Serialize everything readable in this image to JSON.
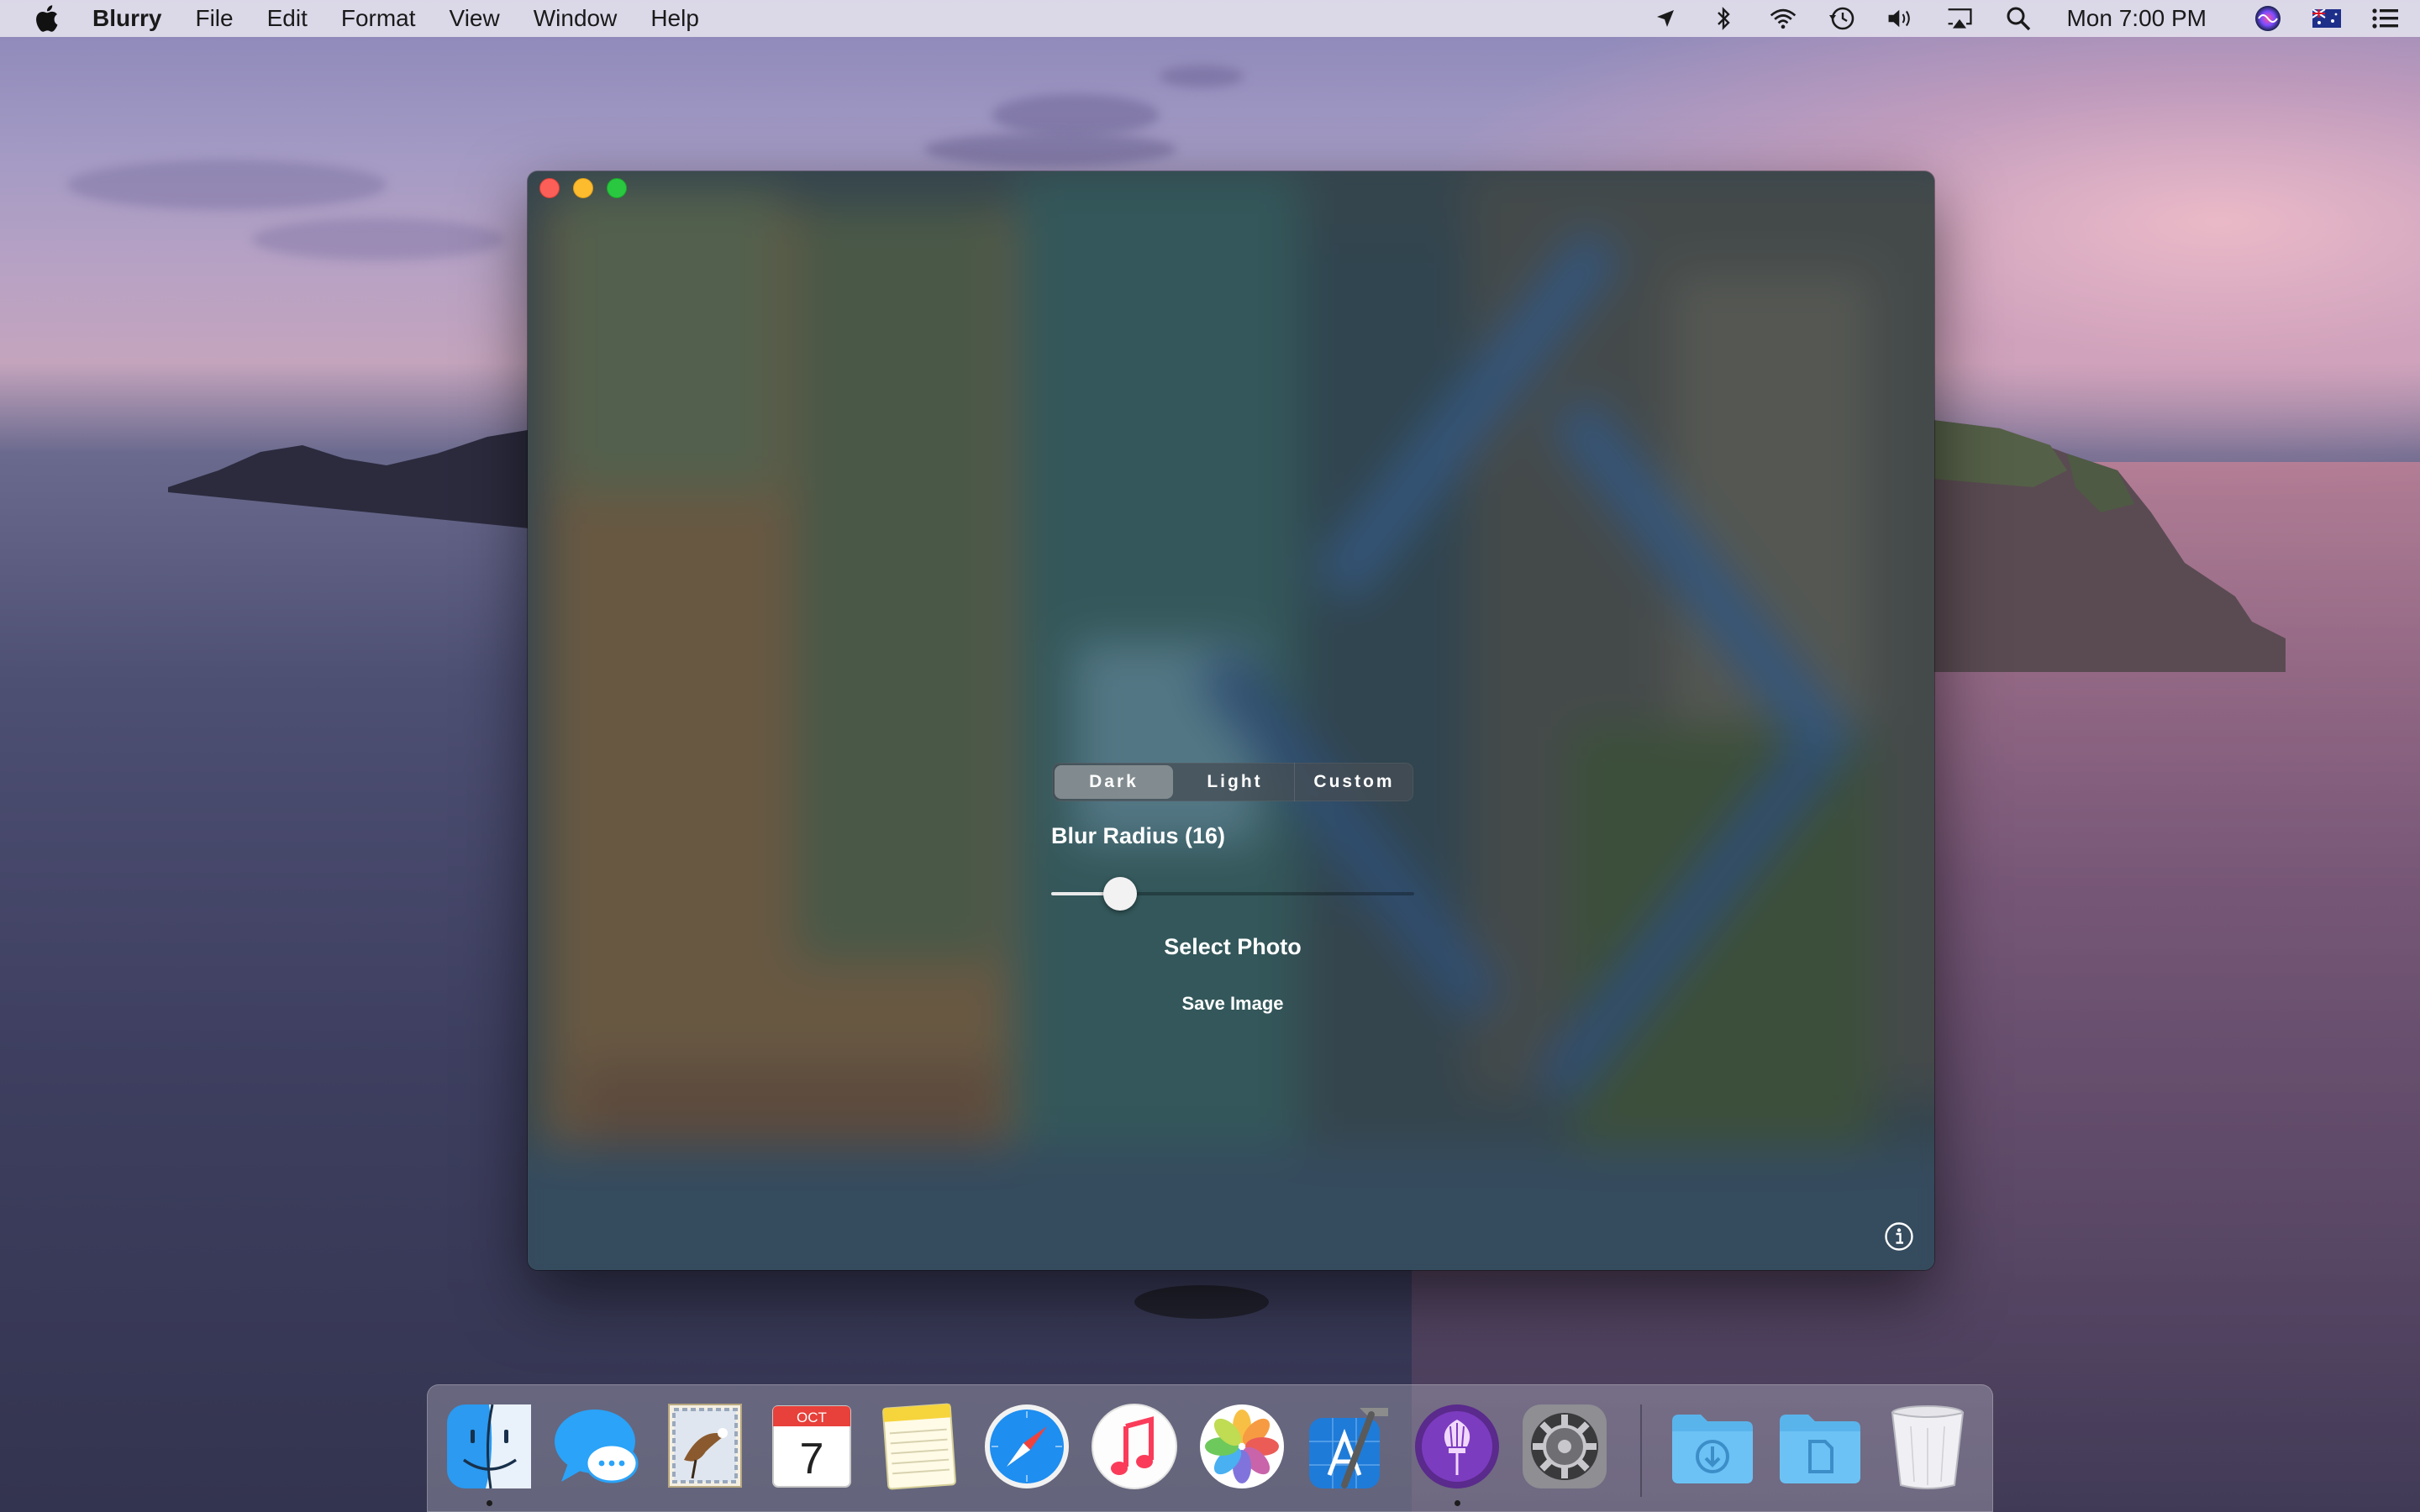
{
  "menubar": {
    "app_name": "Blurry",
    "menus": [
      "File",
      "Edit",
      "Format",
      "View",
      "Window",
      "Help"
    ],
    "clock": "Mon 7:00 PM",
    "status_icons": [
      "location-icon",
      "bluetooth-icon",
      "wifi-icon",
      "time-machine-icon",
      "volume-icon",
      "airplay-icon",
      "spotlight-icon",
      "siri-icon",
      "input-source-flag-icon",
      "notification-center-icon"
    ]
  },
  "window": {
    "modes": [
      "Dark",
      "Light",
      "Custom"
    ],
    "selected_mode": "Dark",
    "blur_radius_label": "Blur Radius (16)",
    "blur_radius_slider": 0.19,
    "select_photo": "Select Photo",
    "save_image": "Save Image",
    "info_icon": "info-icon"
  },
  "dock": {
    "apps": [
      {
        "name": "Finder",
        "icon": "finder-icon",
        "running": true
      },
      {
        "name": "Messages",
        "icon": "messages-icon",
        "running": false
      },
      {
        "name": "Mail",
        "icon": "mail-icon",
        "running": false
      },
      {
        "name": "Calendar",
        "icon": "calendar-icon",
        "running": false,
        "month": "OCT",
        "day": "7"
      },
      {
        "name": "Notes",
        "icon": "notes-icon",
        "running": false
      },
      {
        "name": "Safari",
        "icon": "safari-icon",
        "running": false
      },
      {
        "name": "Music",
        "icon": "music-icon",
        "running": false
      },
      {
        "name": "Photos",
        "icon": "photos-icon",
        "running": false
      },
      {
        "name": "Xcode",
        "icon": "xcode-icon",
        "running": false
      },
      {
        "name": "Blurry",
        "icon": "blurry-icon",
        "running": true
      },
      {
        "name": "System Preferences",
        "icon": "system-preferences-icon",
        "running": false
      }
    ],
    "stacks": [
      {
        "name": "Downloads",
        "icon": "downloads-folder-icon"
      },
      {
        "name": "Documents",
        "icon": "documents-folder-icon"
      },
      {
        "name": "Trash",
        "icon": "trash-icon"
      }
    ]
  },
  "colors": {
    "accent_active_segment": "#8c9498",
    "traffic_close": "#fc5f57",
    "traffic_minimize": "#fdbc2e",
    "traffic_zoom": "#29c840"
  }
}
